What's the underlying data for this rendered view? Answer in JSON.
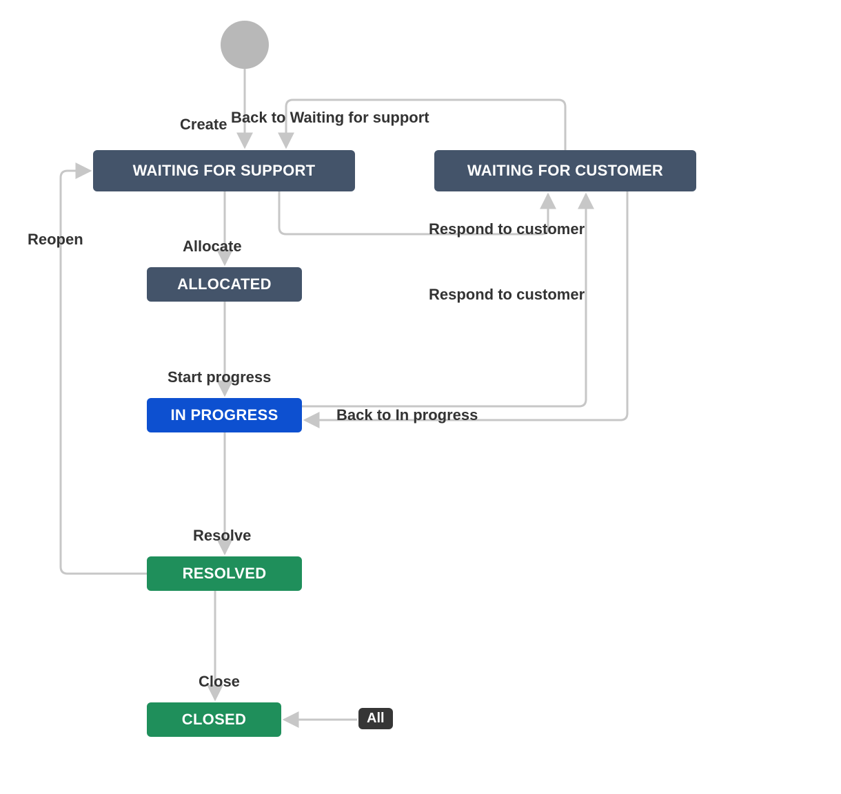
{
  "colors": {
    "navy": "#44546a",
    "blue": "#0d50d0",
    "green": "#1f8f5b",
    "start": "#b8b8b8",
    "edge": "#c7c7c7",
    "text": "#333333",
    "alltag": "#363636"
  },
  "start_node": {
    "kind": "circle"
  },
  "states": {
    "waiting_support": {
      "label": "WAITING FOR SUPPORT",
      "color_key": "navy"
    },
    "waiting_customer": {
      "label": "WAITING FOR CUSTOMER",
      "color_key": "navy"
    },
    "allocated": {
      "label": "ALLOCATED",
      "color_key": "navy"
    },
    "in_progress": {
      "label": "IN PROGRESS",
      "color_key": "blue"
    },
    "resolved": {
      "label": "RESOLVED",
      "color_key": "green"
    },
    "closed": {
      "label": "CLOSED",
      "color_key": "green"
    }
  },
  "transitions": {
    "create": {
      "label": "Create",
      "from": "start",
      "to": "waiting_support"
    },
    "back_to_waiting": {
      "label": "Back to Waiting for support",
      "from": "waiting_customer",
      "to": "waiting_support"
    },
    "reopen": {
      "label": "Reopen",
      "from": "resolved",
      "to": "waiting_support"
    },
    "allocate": {
      "label": "Allocate",
      "from": "waiting_support",
      "to": "allocated"
    },
    "respond1": {
      "label": "Respond to customer",
      "from": "waiting_support",
      "to": "waiting_customer"
    },
    "respond2": {
      "label": "Respond to customer",
      "from": "in_progress",
      "to": "waiting_customer"
    },
    "start_progress": {
      "label": "Start progress",
      "from": "allocated",
      "to": "in_progress"
    },
    "back_to_inprog": {
      "label": "Back to In progress",
      "from": "waiting_customer",
      "to": "in_progress"
    },
    "resolve": {
      "label": "Resolve",
      "from": "in_progress",
      "to": "resolved"
    },
    "close": {
      "label": "Close",
      "from": "resolved",
      "to": "closed"
    },
    "all_to_closed": {
      "label": "All",
      "from": "*",
      "to": "closed"
    }
  }
}
